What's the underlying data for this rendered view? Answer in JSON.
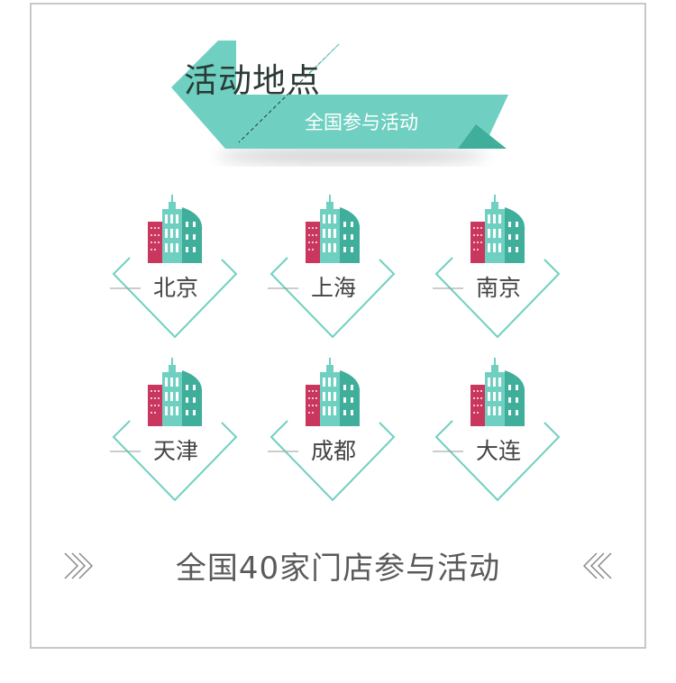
{
  "banner": {
    "title": "活动地点",
    "subtitle": "全国参与活动"
  },
  "cities": [
    {
      "name": "北京"
    },
    {
      "name": "上海"
    },
    {
      "name": "南京"
    },
    {
      "name": "天津"
    },
    {
      "name": "成都"
    },
    {
      "name": "大连"
    }
  ],
  "footer": {
    "text": "全国40家门店参与活动"
  },
  "colors": {
    "teal": "#6fd0c1",
    "teal_dark": "#3fae9a",
    "crimson": "#c9365e",
    "border": "#c8c8c8"
  },
  "icons": [
    "building-icon",
    "double-chevron-right-icon",
    "double-chevron-left-icon"
  ]
}
